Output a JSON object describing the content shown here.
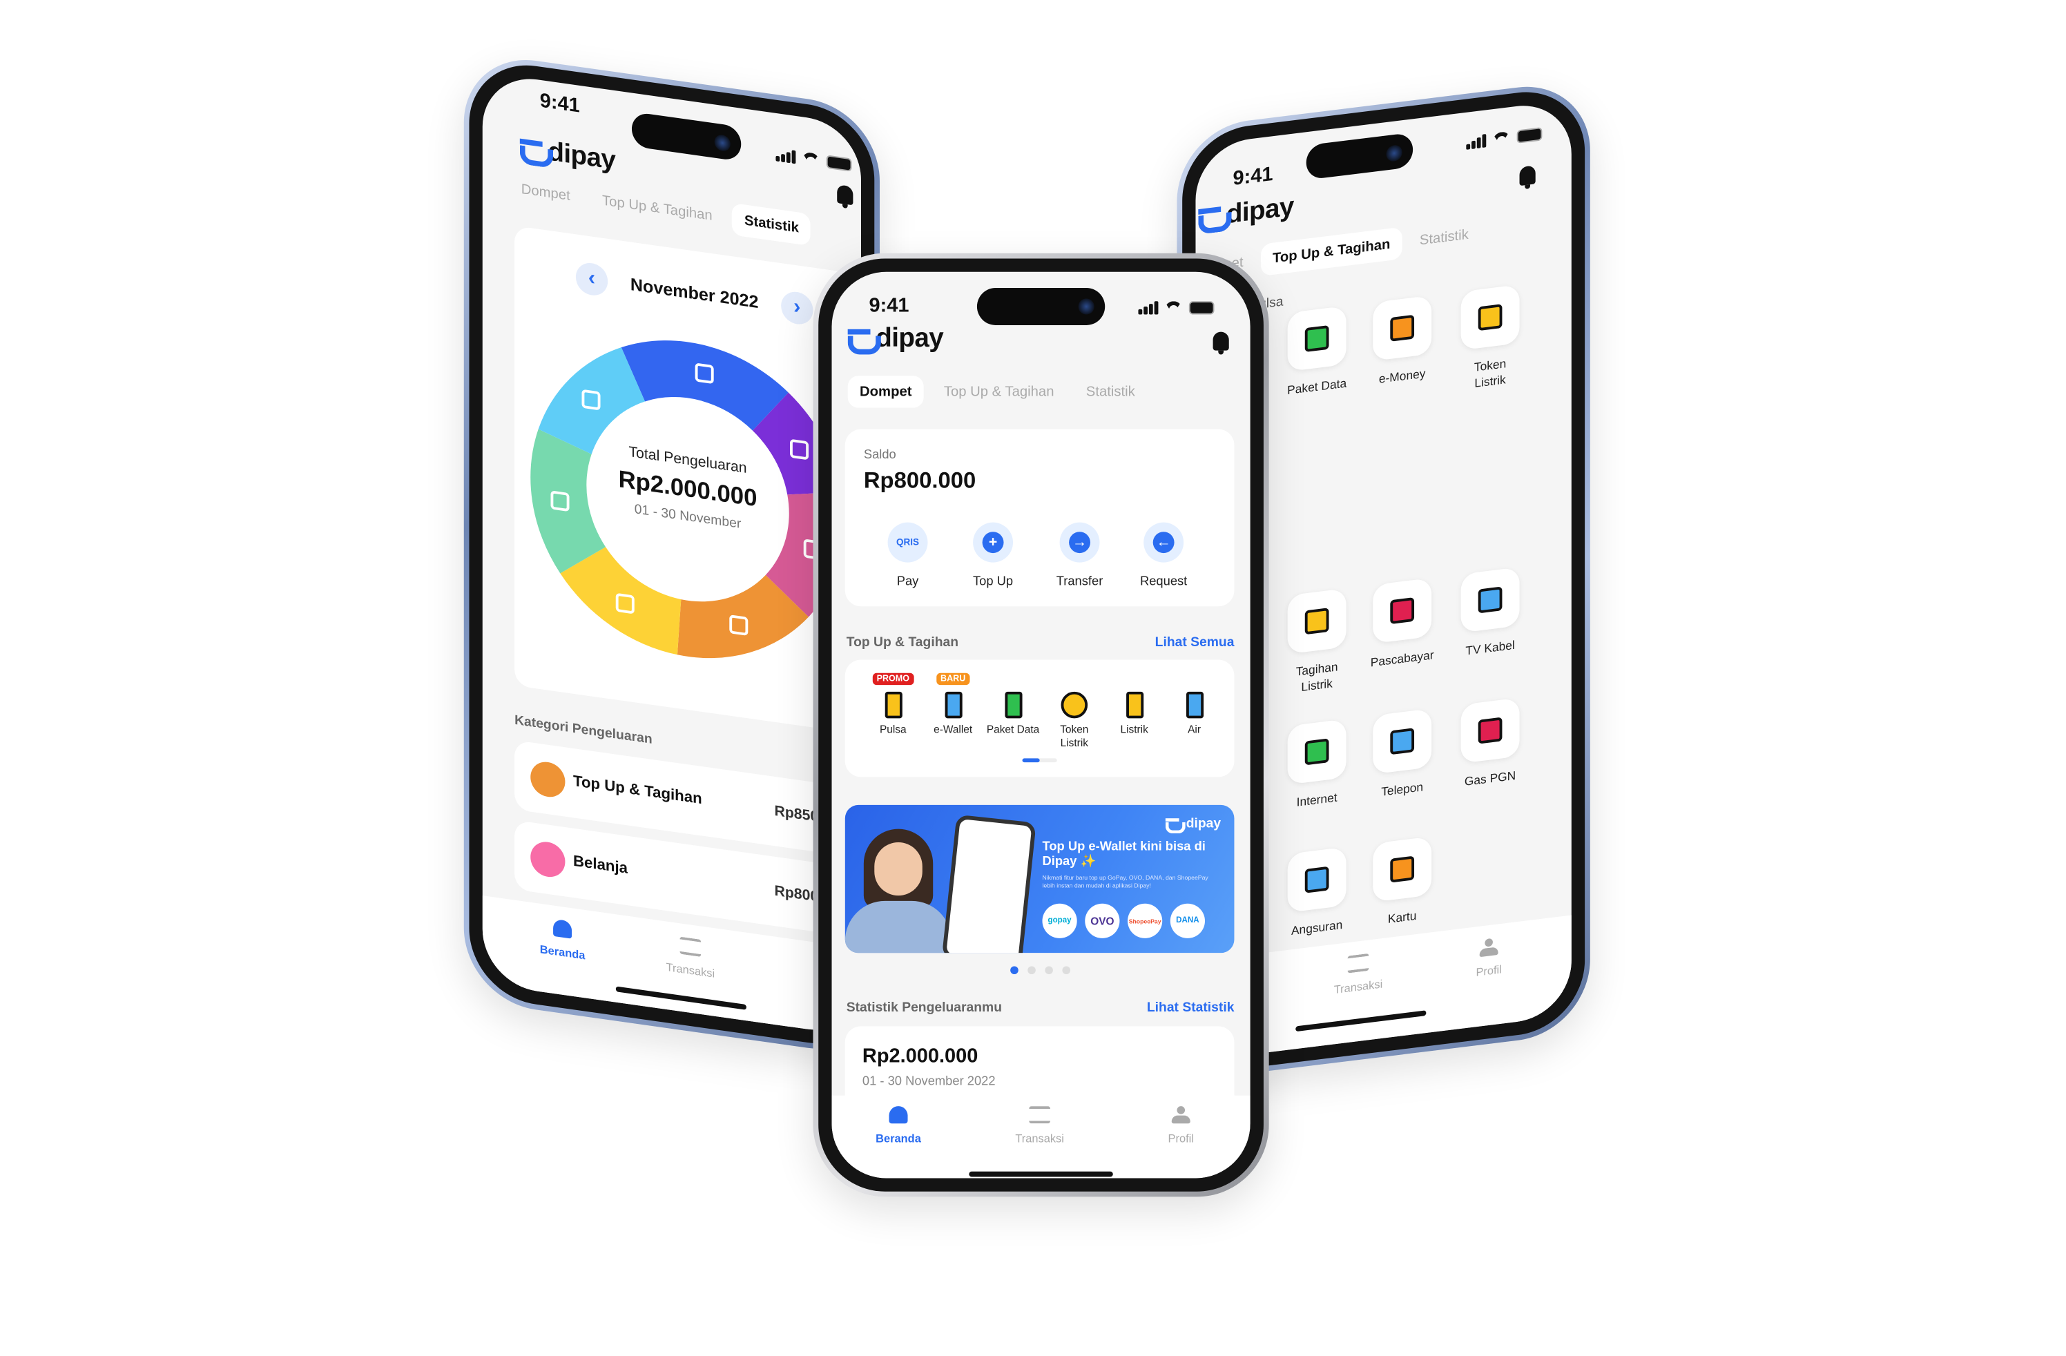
{
  "status_bar": {
    "time": "9:41"
  },
  "brand": {
    "name": "dipay",
    "color": "#2A6CF0"
  },
  "tabs": [
    "Dompet",
    "Top Up & Tagihan",
    "Statistik"
  ],
  "center_phone": {
    "active_tab": "Dompet",
    "balance": {
      "label": "Saldo",
      "amount": "Rp800.000"
    },
    "actions": [
      {
        "label": "Pay",
        "icon": "qris-icon",
        "glyph": "QRIS"
      },
      {
        "label": "Top Up",
        "icon": "plus-icon",
        "glyph": "+"
      },
      {
        "label": "Transfer",
        "icon": "arrow-right-icon",
        "glyph": "→"
      },
      {
        "label": "Request",
        "icon": "arrow-left-icon",
        "glyph": "←"
      }
    ],
    "topup_section": {
      "title": "Top Up & Tagihan",
      "link": "Lihat Semua"
    },
    "services": [
      {
        "label": "Pulsa",
        "badge": "PROMO",
        "badge_color": "#E02020",
        "icon": "phone-signal-icon"
      },
      {
        "label": "e-Wallet",
        "badge": "BARU",
        "badge_color": "#F7931E",
        "icon": "wallet-icon"
      },
      {
        "label": "Paket Data",
        "icon": "phone-data-icon"
      },
      {
        "label": "Token\nListrik",
        "icon": "lightning-icon"
      },
      {
        "label": "Listrik",
        "icon": "electric-bill-icon"
      },
      {
        "label": "Air",
        "icon": "water-tap-icon"
      }
    ],
    "banner": {
      "brand": "dipay",
      "title": "Top Up e-Wallet kini bisa di Dipay ✨",
      "subtitle": "Nikmati fitur baru top up GoPay, OVO, DANA, dan ShopeePay lebih instan dan mudah di aplikasi Dipay!",
      "wallets": [
        "gopay",
        "OVO",
        "ShopeePay",
        "DANA"
      ],
      "page": 1,
      "pages": 4
    },
    "stats_section": {
      "title": "Statistik Pengeluaranmu",
      "link": "Lihat Statistik",
      "amount": "Rp2.000.000",
      "period": "01 - 30 November 2022"
    },
    "nav": [
      {
        "label": "Beranda",
        "active": true
      },
      {
        "label": "Transaksi"
      },
      {
        "label": "Profil"
      }
    ]
  },
  "left_phone": {
    "active_tab": "Statistik",
    "month": "November 2022",
    "donut": {
      "title": "Total Pengeluaran",
      "amount": "Rp2.000.000",
      "period": "01 - 30 November",
      "segments": [
        {
          "icon": "food-icon",
          "color": "#3366F0",
          "share": 18
        },
        {
          "icon": "music-icon",
          "color": "#7B2FD8",
          "share": 11
        },
        {
          "icon": "shopping-bag-icon",
          "color": "#D65A95",
          "share": 14
        },
        {
          "icon": "bill-icon",
          "color": "#EE9335",
          "share": 15
        },
        {
          "icon": "cards-icon",
          "color": "#FDD236",
          "share": 14
        },
        {
          "icon": "transport-icon",
          "color": "#77D9AE",
          "share": 15
        },
        {
          "icon": "health-icon",
          "color": "#5FCDF7",
          "share": 13
        }
      ]
    },
    "category_title": "Kategori Pengeluaran",
    "categories": [
      {
        "label": "Top Up & Tagihan",
        "amount": "Rp850",
        "color": "#EE9335"
      },
      {
        "label": "Belanja",
        "amount": "Rp800",
        "color": "#F86CA7"
      }
    ],
    "nav": [
      {
        "label": "Beranda",
        "active": true
      },
      {
        "label": "Transaksi"
      }
    ]
  },
  "right_phone": {
    "active_tab": "Top Up & Tagihan",
    "section": "Isi Pulsa",
    "tiles": [
      {
        "label": "Paket Data",
        "icon": "phone-data-icon"
      },
      {
        "label": "e-Money",
        "icon": "emoney-card-icon"
      },
      {
        "label": "Token\nListrik",
        "icon": "lightning-icon"
      },
      {
        "label": "Tagihan\nListrik",
        "icon": "electric-bill-icon"
      },
      {
        "label": "Pascabayar",
        "icon": "postpaid-icon"
      },
      {
        "label": "TV Kabel",
        "icon": "tv-icon"
      },
      {
        "label": "Internet",
        "icon": "router-icon"
      },
      {
        "label": "Telepon",
        "icon": "telephone-icon"
      },
      {
        "label": "Gas PGN",
        "icon": "gas-icon"
      },
      {
        "label": "Angsuran",
        "icon": "installment-icon"
      },
      {
        "label": "Kartu",
        "icon": "credit-card-icon"
      }
    ],
    "nav": [
      {
        "label": "Transaksi"
      },
      {
        "label": "Profil"
      }
    ]
  }
}
